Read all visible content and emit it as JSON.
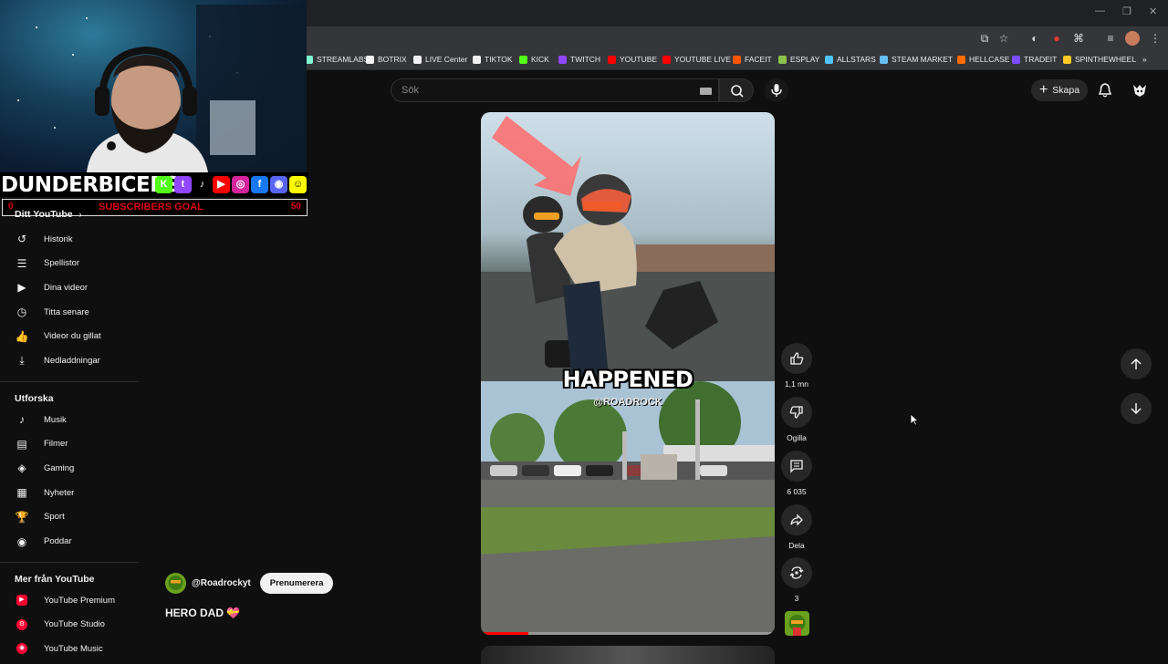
{
  "browser": {
    "bookmarks": [
      {
        "label": "STREAMLABS",
        "color": "#80f5d2"
      },
      {
        "label": "BOTRIX",
        "color": "#f1f1f1"
      },
      {
        "label": "LIVE Center",
        "color": "#f1f1f1"
      },
      {
        "label": "TIKTOK",
        "color": "#f1f1f1"
      },
      {
        "label": "KICK",
        "color": "#53fc18"
      },
      {
        "label": "TWITCH",
        "color": "#9146ff"
      },
      {
        "label": "YOUTUBE",
        "color": "#ff0000"
      },
      {
        "label": "YOUTUBE LIVE",
        "color": "#ff0000"
      },
      {
        "label": "FACEIT",
        "color": "#ff5500"
      },
      {
        "label": "ESPLAY",
        "color": "#8bc34a"
      },
      {
        "label": "ALLSTARS",
        "color": "#4fc3f7"
      },
      {
        "label": "STEAM MARKET",
        "color": "#66c0f4"
      },
      {
        "label": "HELLCASE",
        "color": "#ff6d00"
      },
      {
        "label": "TRADEIT",
        "color": "#7c4dff"
      },
      {
        "label": "SPINTHEWHEEL",
        "color": "#ffca28"
      }
    ],
    "more": "»"
  },
  "header": {
    "search_placeholder": "Sök",
    "create_label": "Skapa"
  },
  "overlay": {
    "streamer_name": "DUNDERBICEPS",
    "goal_start": "0",
    "goal_label": "SUBSCRIBERS GOAL",
    "goal_end": "50",
    "socials": [
      {
        "name": "kick",
        "color": "#53fc18",
        "glyph": "K"
      },
      {
        "name": "twitch",
        "color": "#9146ff",
        "glyph": "t"
      },
      {
        "name": "tiktok",
        "color": "#000000",
        "glyph": "♪"
      },
      {
        "name": "youtube",
        "color": "#ff0000",
        "glyph": "▶"
      },
      {
        "name": "instagram",
        "color": "#d6249f",
        "glyph": "◎"
      },
      {
        "name": "facebook",
        "color": "#1877f2",
        "glyph": "f"
      },
      {
        "name": "discord",
        "color": "#5865f2",
        "glyph": "◉"
      },
      {
        "name": "snapchat",
        "color": "#fffc00",
        "glyph": "☺"
      }
    ]
  },
  "sidebar": {
    "you_header": "Ditt YouTube",
    "you_items": [
      {
        "label": "Historik",
        "icon": "history-icon"
      },
      {
        "label": "Spellistor",
        "icon": "playlists-icon"
      },
      {
        "label": "Dina videor",
        "icon": "your-videos-icon"
      },
      {
        "label": "Titta senare",
        "icon": "watch-later-icon"
      },
      {
        "label": "Videor du gillat",
        "icon": "liked-videos-icon"
      },
      {
        "label": "Nedladdningar",
        "icon": "downloads-icon"
      }
    ],
    "explore_header": "Utforska",
    "explore_items": [
      {
        "label": "Musik",
        "icon": "music-icon"
      },
      {
        "label": "Filmer",
        "icon": "movies-icon"
      },
      {
        "label": "Gaming",
        "icon": "gaming-icon"
      },
      {
        "label": "Nyheter",
        "icon": "news-icon"
      },
      {
        "label": "Sport",
        "icon": "sport-icon"
      },
      {
        "label": "Poddar",
        "icon": "podcasts-icon"
      }
    ],
    "more_header": "Mer från YouTube",
    "more_items": [
      {
        "label": "YouTube Premium",
        "icon": "youtube-premium-icon"
      },
      {
        "label": "YouTube Studio",
        "icon": "youtube-studio-icon"
      },
      {
        "label": "YouTube Music",
        "icon": "youtube-music-icon"
      }
    ]
  },
  "short": {
    "overlay_text": "HAPPENED",
    "overlay_handle": "@ROADROCK",
    "progress": 0.16,
    "channel_handle": "@Roadrockyt",
    "subscribe_label": "Prenumerera",
    "title": "HERO DAD 💝",
    "actions": {
      "like_count": "1,1 mn",
      "dislike_label": "Ogilla",
      "comments_count": "6 035",
      "share_label": "Dela",
      "remix_count": "3"
    }
  }
}
